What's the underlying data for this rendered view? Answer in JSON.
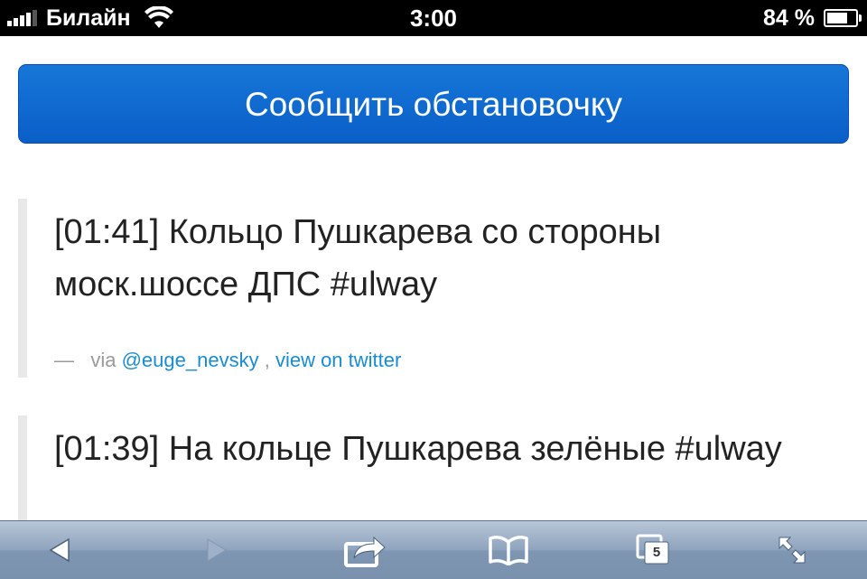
{
  "status_bar": {
    "carrier": "Билайн",
    "time": "3:00",
    "battery_percent": "84 %",
    "battery_level": 0.84,
    "signal_bars": 4
  },
  "page": {
    "report_button_label": "Сообщить обстановочку",
    "tweets": [
      {
        "text": "[01:41] Кольцо Пушкарева со стороны моск.шоссе ДПС #ulway",
        "meta_dash": "—",
        "via": "via",
        "author": "@euge_nevsky",
        "separator": ",",
        "view_link": "view on twitter"
      },
      {
        "text": "[01:39] На кольце Пушкарева зелёные #ulway"
      }
    ]
  },
  "toolbar": {
    "back_icon": "back-arrow-icon",
    "forward_icon": "forward-arrow-icon",
    "share_icon": "share-icon",
    "bookmarks_icon": "bookmarks-icon",
    "tabs_icon": "tabs-icon",
    "tabs_count": "5",
    "fullscreen_icon": "fullscreen-icon"
  },
  "colors": {
    "button_blue": "#0a5ec8",
    "link_blue": "#1a8bcf",
    "toolbar": "#8ea3bd"
  }
}
